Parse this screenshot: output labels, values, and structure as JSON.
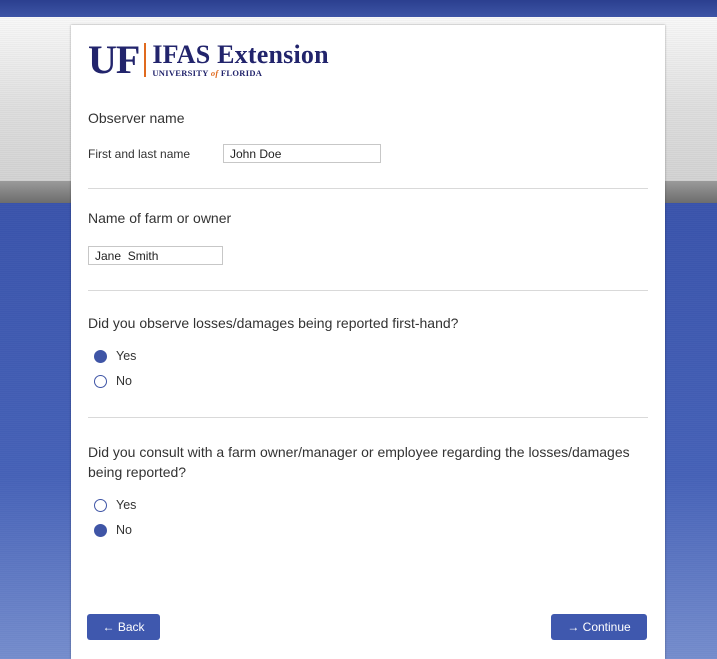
{
  "brand": {
    "logo_mark": "UF",
    "logo_title": "IFAS Extension",
    "logo_sub_before": "UNIVERSITY ",
    "logo_sub_of": "of",
    "logo_sub_after": " FLORIDA"
  },
  "observer": {
    "heading": "Observer name",
    "field_label": "First and last name",
    "value": "John Doe"
  },
  "farm": {
    "heading": "Name of farm or owner",
    "value": "Jane  Smith"
  },
  "q1": {
    "question": "Did you observe losses/damages being reported first-hand?",
    "options": [
      {
        "label": "Yes",
        "checked": true
      },
      {
        "label": "No",
        "checked": false
      }
    ]
  },
  "q2": {
    "question_line1": "Did you consult with a farm owner/manager or employee regarding the losses/damages",
    "question_line2": "being reported?",
    "options": [
      {
        "label": "Yes",
        "checked": false
      },
      {
        "label": "No",
        "checked": true
      }
    ]
  },
  "nav": {
    "back_label": "← Back",
    "continue_label": "→ Continue"
  },
  "colors": {
    "accent": "#3f58ae",
    "brand_navy": "#22246c",
    "brand_orange": "#e06a1e"
  }
}
